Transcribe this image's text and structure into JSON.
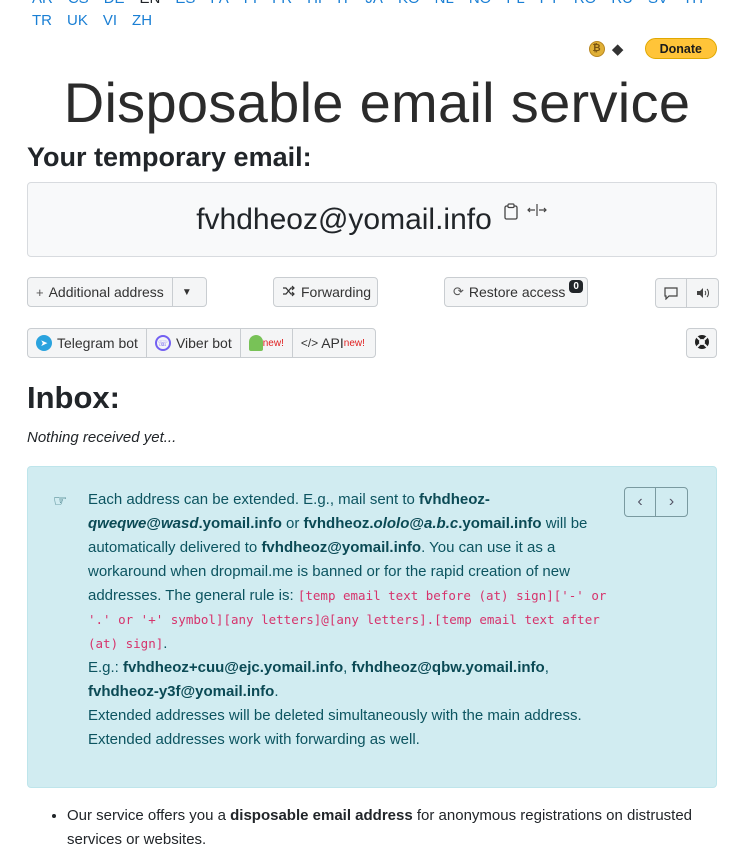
{
  "languages": [
    "AR",
    "CS",
    "DE",
    "EN",
    "ES",
    "FA",
    "FI",
    "FR",
    "HI",
    "IT",
    "JA",
    "KO",
    "NL",
    "NO",
    "PL",
    "PT",
    "RO",
    "RU",
    "SV",
    "TH",
    "TR",
    "UK",
    "VI",
    "ZH"
  ],
  "current_language": "EN",
  "donate": {
    "label": "Donate",
    "crypto_icons": [
      "bitcoin-icon",
      "ethereum-icon"
    ]
  },
  "title": "Disposable email service",
  "subtitle": "Your temporary email:",
  "email": "fvhdheoz@yomail.info",
  "toolbar": {
    "additional_address": "Additional address",
    "forwarding": "Forwarding",
    "restore_access": "Restore access",
    "restore_badge": "0"
  },
  "integrations": {
    "telegram": "Telegram bot",
    "viber": "Viber bot",
    "android_new": "new!",
    "api": "API",
    "api_new": "new!"
  },
  "inbox": {
    "heading": "Inbox:",
    "empty_text": "Nothing received yet..."
  },
  "info": {
    "p1_a": "Each address can be extended. E.g., mail sent to ",
    "ex1_b1": "fvhdheoz-",
    "ex1_i": "qweqwe",
    "ex1_b2": "@",
    "ex1_i2": "wasd",
    "ex1_b3": ".yomail.info",
    "or": " or ",
    "ex2_b1": "fvhdheoz.",
    "ex2_i": "ololo",
    "ex2_b2": "@",
    "ex2_i2": "a.b.c",
    "ex2_b3": ".yomail.info",
    "will": " will be automatically delivered to ",
    "main": "fvhdheoz@yomail.info",
    "p1_b": ". You can use it as a workaround when dropmail.me is banned or for the rapid creation of new addresses. The general rule is: ",
    "rule": "[temp email text before (at) sign]['-' or '.' or '+' symbol][any letters]@[any letters].[temp email text after (at) sign]",
    "eg": "E.g.: ",
    "eg1": "fvhdheoz+cuu@ejc.yomail.info",
    "eg2": "fvhdheoz@qbw.yomail.info",
    "eg3": "fvhdheoz-y3f@yomail.info",
    "deleted": "Extended addresses will be deleted simultaneously with the main address.",
    "fwd": "Extended addresses work with forwarding as well."
  },
  "bullet": {
    "a": "Our service offers you a ",
    "b": "disposable email address",
    "c": " for anonymous registrations on distrusted services or websites."
  }
}
